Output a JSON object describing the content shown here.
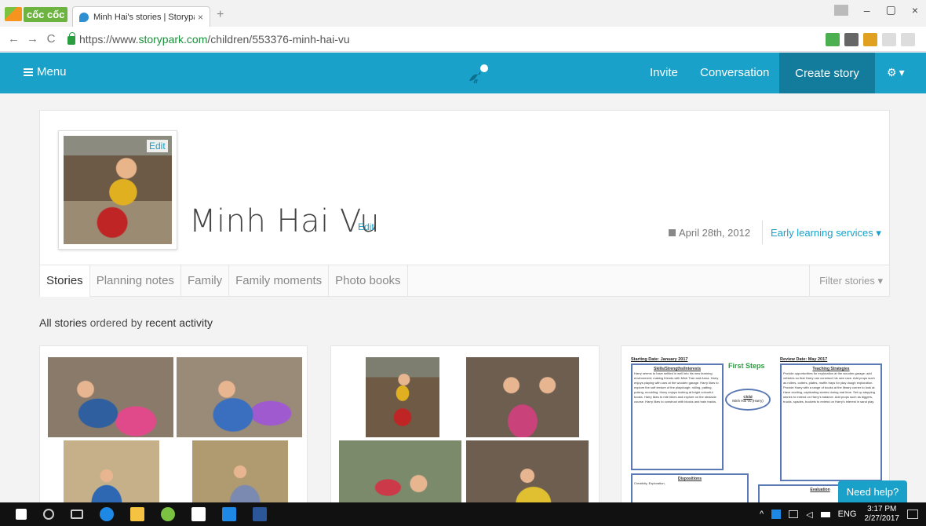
{
  "browser": {
    "brand": "cốc cốc",
    "tab_title": "Minh Hai's stories | Storypa",
    "tab_close": "×",
    "new_tab": "+",
    "url_prefix": "https://www.",
    "url_host": "storypark.com",
    "url_path": "/children/553376-minh-hai-vu",
    "back": "←",
    "forward": "→",
    "reload": "C",
    "min": "–",
    "max": "▢",
    "close": "×"
  },
  "header": {
    "menu_label": "Menu",
    "invite": "Invite",
    "conversation": "Conversation",
    "create_story": "Create story",
    "settings_caret": "▾"
  },
  "profile": {
    "photo_edit": "Edit",
    "name": "Minh Hai Vu",
    "name_edit": "Edit",
    "birthday": "April 28th, 2012",
    "services": "Early learning services ▾"
  },
  "tabs": [
    "Stories",
    "Planning notes",
    "Family",
    "Family moments",
    "Photo books"
  ],
  "filter": "Filter stories ▾",
  "ordered": {
    "prefix": "All stories",
    "middle": "ordered by",
    "suffix": "recent activity"
  },
  "doc": {
    "start": "Starting Date: January 2017",
    "review": "Review Date: May 2017",
    "skills": "Skills/Strengths/Interests",
    "teaching": "Teaching Strategies",
    "child": "Child",
    "child_name": "Minh Hai Vu (Harry)",
    "dispositions": "Dispositions",
    "evaluation": "Evaluation",
    "logo": "First Steps",
    "skills_text": "Harry seems to have settled in well into his new learning environment; making friends with Minh Tran and Anna. Harry enjoys playing with cars at the wooden garage. Harry likes to explore the soft texture of the playdough: rolling, patting, poking, moulding. Harry enjoys looking at bright colourful books. Harry likes to ride bikes and explore on the obstacle course. Harry likes to construct with blocks and train tracks.",
    "teaching_text": "Provide opportunities for exploration at the wooden garage; add vehicles so that Harry can construct his own race. Add props such as rollers, cutters, plates, muffin trays for play dough exploration. Provide Harry with a range of books at the library corner to look at. Have exciting, captivating stories during mat time. Set up stepping stones to extend on Harry's balance. Add props such as diggers, trucks, spades, buckets to extend on Harry's interest in sand play.",
    "disp_text": "Creativity, Exploration,"
  },
  "need_help": "Need help?",
  "taskbar": {
    "lang": "ENG",
    "time": "3:17 PM",
    "date": "2/27/2017"
  },
  "colors": {
    "accent": "#1aa1c9",
    "accent_dark": "#137c9c"
  }
}
